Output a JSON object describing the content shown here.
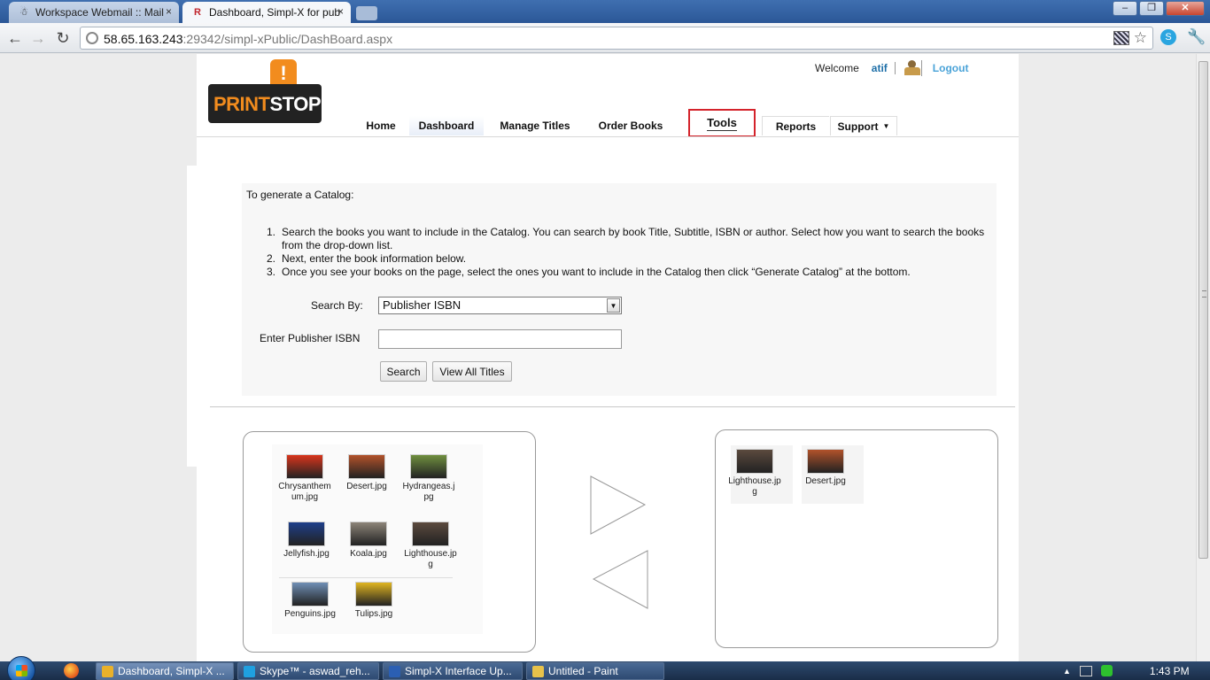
{
  "browser": {
    "tabs": [
      {
        "title": "Workspace Webmail :: Mail",
        "favicon": "webmail-icon"
      },
      {
        "title": "Dashboard, Simpl-X for pub",
        "favicon": "r-icon"
      }
    ],
    "url_host": "58.65.163.243",
    "url_rest": ":29342/simpl-xPublic/DashBoard.aspx"
  },
  "header": {
    "logo": {
      "part1": "PRINT",
      "part2": "STOP",
      "mark": "!"
    },
    "welcome": "Welcome",
    "username": "atif",
    "logout": "Logout"
  },
  "menu": {
    "home": "Home",
    "dashboard": "Dashboard",
    "manage_titles": "Manage Titles",
    "order_books": "Order Books",
    "tools": "Tools",
    "reports": "Reports",
    "support": "Support"
  },
  "catalog": {
    "intro": "To generate a Catalog:",
    "steps": [
      "Search the books you want to include in the Catalog. You can search by book Title, Subtitle, ISBN or author. Select how you want to search the books from the drop-down list.",
      "Next, enter the book information below.",
      "Once you see your books on the page, select the ones you want to include in the Catalog then click “Generate Catalog” at the bottom."
    ],
    "search_by_label": "Search By:",
    "search_by_value": "Publisher ISBN",
    "isbn_label": "Enter Publisher ISBN",
    "isbn_value": "",
    "search_button": "Search",
    "view_all_button": "View All Titles"
  },
  "left_files": [
    {
      "name": "Chrysanthemum.jpg",
      "color": "#d8351c"
    },
    {
      "name": "Desert.jpg",
      "color": "#b2522a"
    },
    {
      "name": "Hydrangeas.jpg",
      "color": "#6f8f3f"
    },
    {
      "name": "Jellyfish.jpg",
      "color": "#1e3f8a"
    },
    {
      "name": "Koala.jpg",
      "color": "#8c8478"
    },
    {
      "name": "Lighthouse.jpg",
      "color": "#5b4a3e"
    },
    {
      "name": "Penguins.jpg",
      "color": "#6f8fb5"
    },
    {
      "name": "Tulips.jpg",
      "color": "#e0b520"
    }
  ],
  "right_files": [
    {
      "name": "Lighthouse.jpg",
      "color": "#5b4a3e"
    },
    {
      "name": "Desert.jpg",
      "color": "#b2522a"
    }
  ],
  "taskbar": {
    "items": [
      {
        "label": "Dashboard, Simpl-X ...",
        "color": "#e9b12a"
      },
      {
        "label": "Skype™ - aswad_reh...",
        "color": "#1fa0e0"
      },
      {
        "label": "Simpl-X Interface Up...",
        "color": "#2b5fb3"
      },
      {
        "label": "Untitled - Paint",
        "color": "#e8c24a"
      }
    ],
    "clock": "1:43 PM"
  }
}
